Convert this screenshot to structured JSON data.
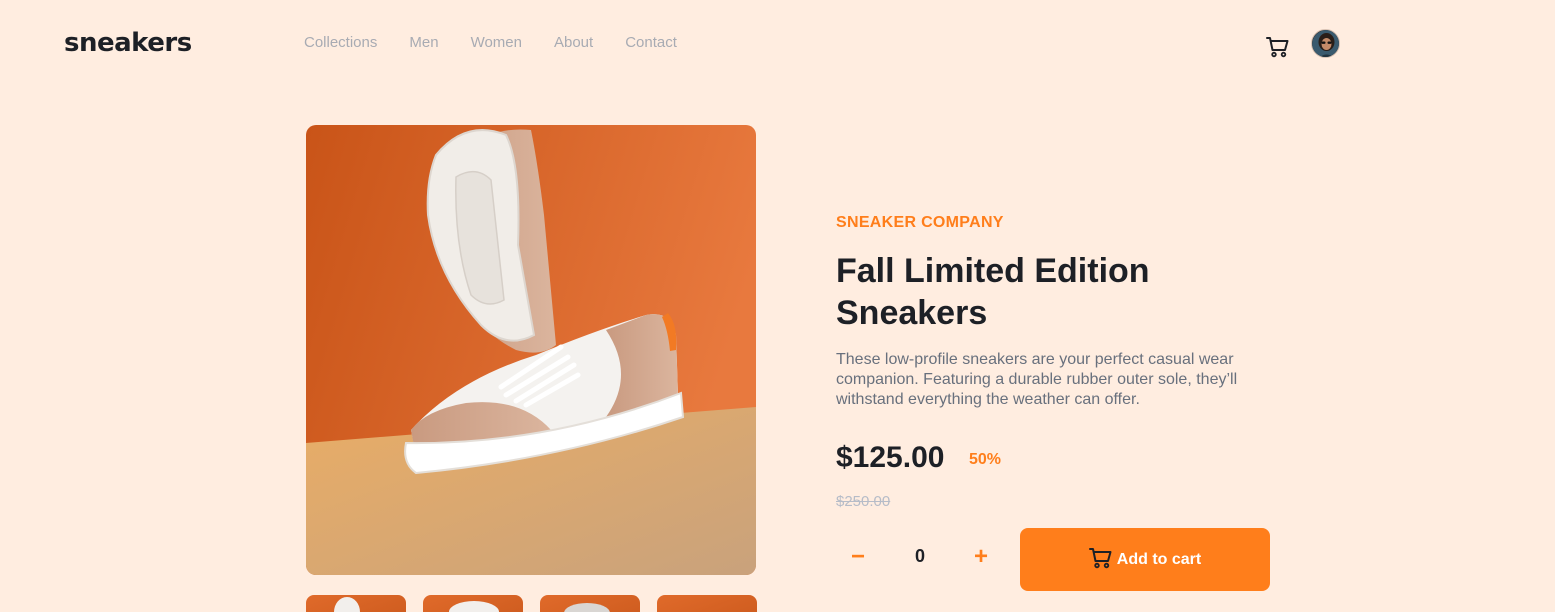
{
  "brand": {
    "logo": "sneakers"
  },
  "nav": [
    "Collections",
    "Men",
    "Women",
    "About",
    "Contact"
  ],
  "header": {
    "cart_icon": "cart-icon",
    "avatar": "user-avatar"
  },
  "product": {
    "company": "SNEAKER COMPANY",
    "title": "Fall Limited Edition Sneakers",
    "description": "These low-profile sneakers are your perfect casual wear companion. Featuring a durable rubber outer sole, they’ll withstand everything the weather can offer.",
    "price": "$125.00",
    "discount": "50%",
    "original_price": "$250.00",
    "quantity": "0",
    "minus_label": "−",
    "plus_label": "+",
    "add_to_cart_label": "Add to cart"
  },
  "colors": {
    "background": "#ffede0",
    "accent": "#ff7e1b",
    "text_dark": "#1d2026",
    "text_muted": "#68707d"
  }
}
